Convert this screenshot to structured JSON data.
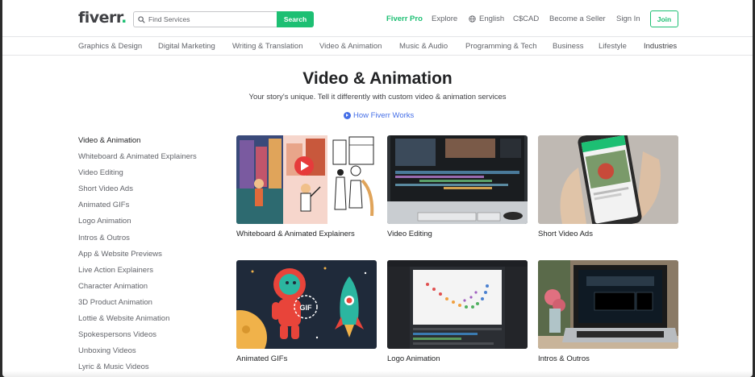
{
  "header": {
    "logo_text": "fiverr",
    "logo_dot": ".",
    "search": {
      "placeholder": "Find Services",
      "value": "",
      "button_label": "Search"
    },
    "nav": {
      "pro": "Fiverr Pro",
      "explore": "Explore",
      "language": "English",
      "currency": "C$CAD",
      "become_seller": "Become a Seller",
      "sign_in": "Sign In",
      "join": "Join"
    }
  },
  "categories": [
    "Graphics & Design",
    "Digital Marketing",
    "Writing & Translation",
    "Video & Animation",
    "Music & Audio",
    "Programming & Tech",
    "Business",
    "Lifestyle",
    "Industries"
  ],
  "hero": {
    "title": "Video & Animation",
    "subtitle": "Your story's unique. Tell it differently with custom video & animation services",
    "how_link": "How Fiverr Works"
  },
  "sidebar": {
    "active": "Video & Animation",
    "items": [
      "Whiteboard & Animated Explainers",
      "Video Editing",
      "Short Video Ads",
      "Animated GIFs",
      "Logo Animation",
      "Intros & Outros",
      "App & Website Previews",
      "Live Action Explainers",
      "Character Animation",
      "3D Product Animation",
      "Lottie & Website Animation",
      "Spokespersons Videos",
      "Unboxing Videos",
      "Lyric & Music Videos"
    ]
  },
  "cards": [
    {
      "title": "Whiteboard & Animated Explainers"
    },
    {
      "title": "Video Editing"
    },
    {
      "title": "Short Video Ads"
    },
    {
      "title": "Animated GIFs",
      "gif_label": "GIF"
    },
    {
      "title": "Logo Animation"
    },
    {
      "title": "Intros & Outros"
    }
  ],
  "colors": {
    "brand": "#1dbf73",
    "link": "#446ee7",
    "text": "#404145"
  }
}
